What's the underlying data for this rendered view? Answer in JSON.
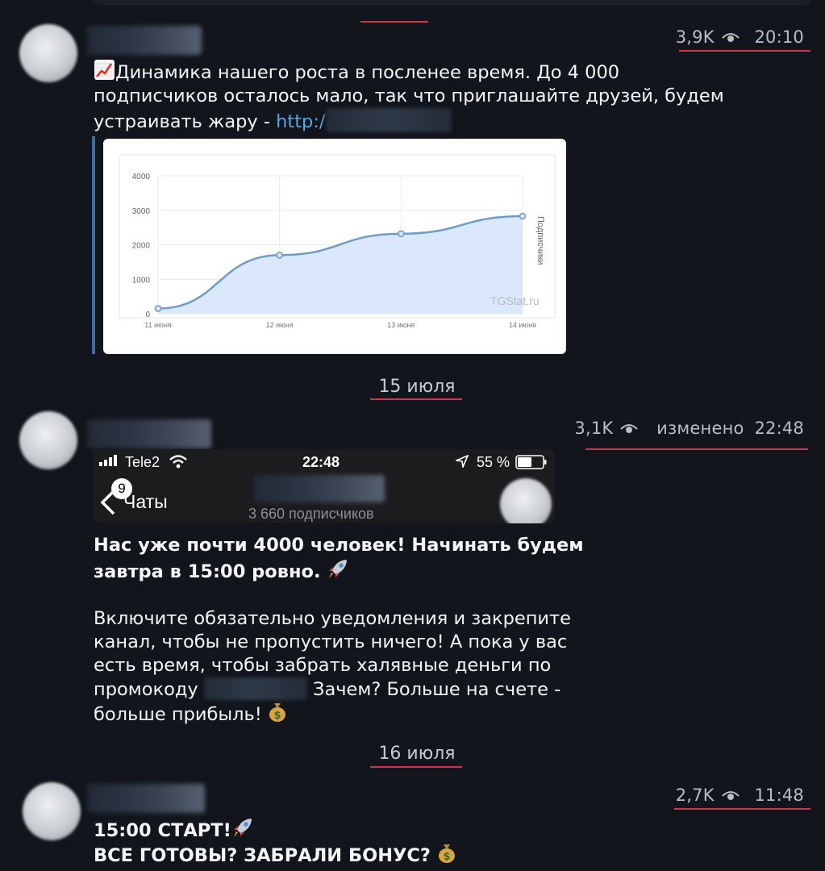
{
  "posts": [
    {
      "views": "3,9K",
      "time": "20:10",
      "edited_label": "",
      "text_line1": "Динамика нашего роста в послeнее время. До 4 000",
      "text_line2": "подписчиков осталось мало, так что приглашайте друзей, будем",
      "text_line3_prefix": "устраивать жару - ",
      "link_text": "http:/"
    },
    {
      "views": "3,1K",
      "edited_label": "изменено",
      "time": "22:48",
      "bold_line1": "Нас уже почти 4000 человек! Начинать будем",
      "bold_line2": "завтра в 15:00 ровно.",
      "body_line1": "Включите обязательно уведомления и закрепите",
      "body_line2": "канал, чтобы не пропустить ничего! А пока у вас",
      "body_line3": "есть время, чтобы забрать халявные деньги по",
      "body_line4_prefix": "промокоду",
      "body_line4_suffix": "Зачем? Больше на счете -",
      "body_line5": "больше прибыль!"
    },
    {
      "views": "2,7K",
      "time": "11:48",
      "bold_line1": "15:00 СТАРТ!",
      "bold_line2": "ВСЕ ГОТОВЫ? ЗАБРАЛИ БОНУС?"
    }
  ],
  "date_separators": [
    "15 июля",
    "16 июля"
  ],
  "phone_screenshot": {
    "carrier": "Tele2",
    "time": "22:48",
    "battery": "55 %",
    "back_label": "Чаты",
    "unread_badge": "9",
    "subscribers": "3 660 подписчиков"
  },
  "chart_data": {
    "type": "area",
    "x": [
      "11 июня",
      "12 июня",
      "13 июня",
      "14 июня"
    ],
    "series": [
      {
        "name": "",
        "values": [
          150,
          1700,
          2320,
          2830
        ]
      }
    ],
    "ylabel": "Подписчики",
    "yticks": [
      0,
      1000,
      2000,
      3000,
      4000
    ],
    "ylim": [
      0,
      4000
    ],
    "watermark": "TGStat.ru",
    "grid": true,
    "line_color": "#6f9bc6",
    "fill_color": "#dbe8fb"
  }
}
